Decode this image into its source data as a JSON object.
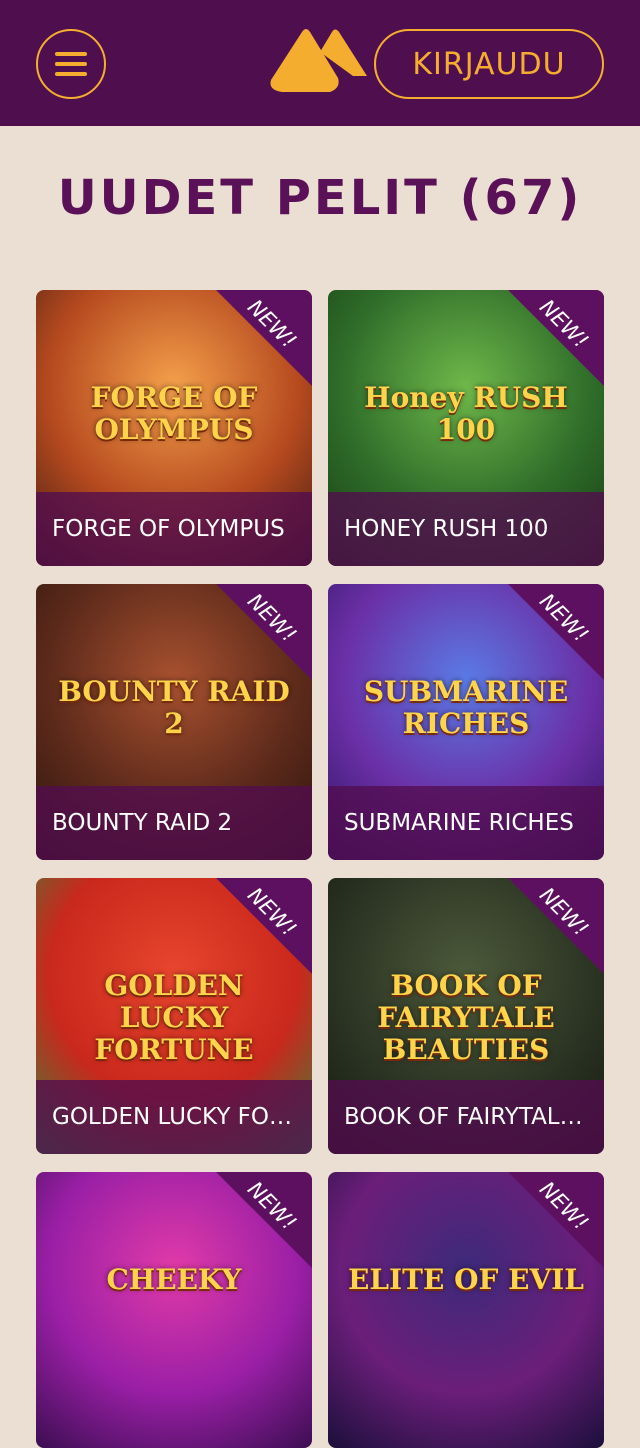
{
  "header": {
    "menu_icon": "hamburger-icon",
    "logo_icon": "mountain-logo-icon",
    "login_label": "KIRJAUDU",
    "colors": {
      "background": "#4f0f4f",
      "accent": "#f5ad2f"
    }
  },
  "page": {
    "title": "UUDET PELIT (67)",
    "background": "#eadfd2"
  },
  "games": [
    {
      "title": "FORGE OF OLYMPUS",
      "badge": "NEW!",
      "art_text": "FORGE OF OLYMPUS",
      "palette": [
        "#f4a04b",
        "#b64a1f",
        "#3e1a12"
      ]
    },
    {
      "title": "HONEY RUSH 100",
      "badge": "NEW!",
      "art_text": "Honey RUSH 100",
      "palette": [
        "#6fb84a",
        "#2f6d2a",
        "#173a12"
      ]
    },
    {
      "title": "BOUNTY RAID 2",
      "badge": "NEW!",
      "art_text": "BOUNTY RAID 2",
      "palette": [
        "#a8512f",
        "#5d2a1b",
        "#2a140e"
      ]
    },
    {
      "title": "SUBMARINE RICHES",
      "badge": "NEW!",
      "art_text": "SUBMARINE RICHES",
      "palette": [
        "#5a7be6",
        "#6b2fa6",
        "#2a1460"
      ]
    },
    {
      "title": "GOLDEN LUCKY FORTUNE",
      "badge": "NEW!",
      "art_text": "GOLDEN LUCKY FORTUNE",
      "palette": [
        "#e8462e",
        "#c9281c",
        "#2f8a3e"
      ]
    },
    {
      "title": "BOOK OF FAIRYTALE BEAUTIES",
      "badge": "NEW!",
      "art_text": "BOOK OF FAIRYTALE BEAUTIES",
      "palette": [
        "#4c5a3a",
        "#2c3424",
        "#141a10"
      ]
    },
    {
      "title": "",
      "badge": "NEW!",
      "art_text": "CHEEKY",
      "palette": [
        "#e13aa8",
        "#9a1fa6",
        "#3c0e52"
      ]
    },
    {
      "title": "",
      "badge": "NEW!",
      "art_text": "ELITE OF EVIL",
      "palette": [
        "#3d2a7a",
        "#6b1e7a",
        "#1b0f3a"
      ]
    }
  ]
}
